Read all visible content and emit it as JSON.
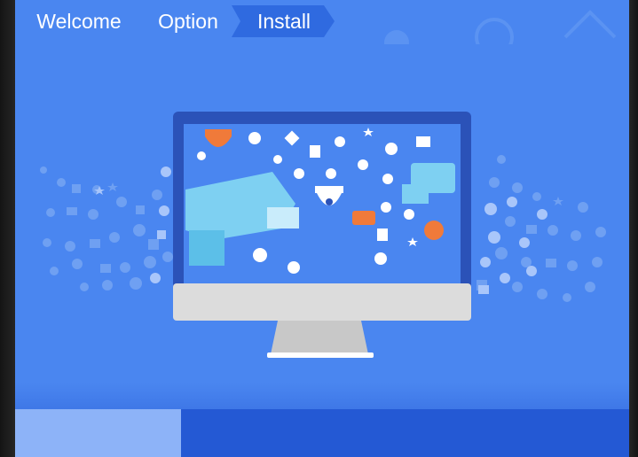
{
  "wizard": {
    "steps": [
      {
        "label": "Welcome",
        "state": "done"
      },
      {
        "label": "Option",
        "state": "done"
      },
      {
        "label": "Install",
        "state": "current"
      }
    ]
  },
  "progress": {
    "value_fraction": 0.27
  },
  "colors": {
    "background": "#4a86f0",
    "active_step": "#2f6ae0",
    "progress_track": "#2459d4",
    "progress_fill": "#8db3f8",
    "accent_orange": "#f07a3a"
  },
  "illustration": {
    "icons": [
      "monitor-icon",
      "security-camera-icon",
      "dome-camera-icon",
      "gear-icon",
      "star-icon",
      "mail-icon",
      "microphone-icon",
      "map-pin-icon",
      "flag-icon",
      "film-icon"
    ]
  }
}
